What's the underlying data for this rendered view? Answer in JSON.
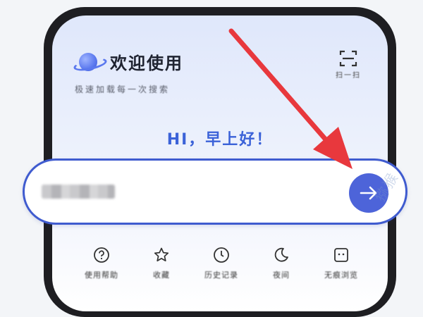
{
  "header": {
    "title": "欢迎使用",
    "subtitle": "极速加载每一次搜索",
    "scan_label": "扫一扫"
  },
  "greeting": "HI，早上好！",
  "search": {
    "query": "██████"
  },
  "quick_actions": [
    {
      "label": "使用帮助",
      "icon": "help-circle-icon"
    },
    {
      "label": "收藏",
      "icon": "star-icon"
    },
    {
      "label": "历史记录",
      "icon": "clock-icon"
    },
    {
      "label": "夜间",
      "icon": "moon-icon"
    },
    {
      "label": "无痕浏览",
      "icon": "incognito-icon"
    }
  ],
  "colors": {
    "accent": "#4d64d9",
    "greeting": "#3b62d8",
    "annotation_arrow": "#e8383d"
  }
}
